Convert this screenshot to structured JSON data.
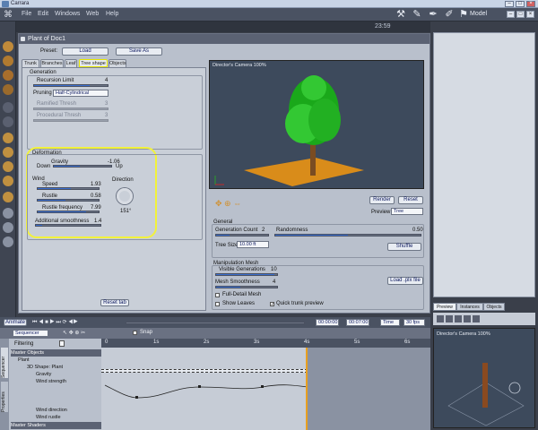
{
  "window": {
    "title": "Carrara",
    "min": "–",
    "max": "□",
    "close": "×"
  },
  "menu": {
    "items": [
      "File",
      "Edit",
      "Windows",
      "Web",
      "Help"
    ],
    "room": "Model",
    "clock": "23:59"
  },
  "plant_panel": {
    "title": "Plant of Doc1",
    "preset_label": "Preset:",
    "load": "Load",
    "save_as": "Save As",
    "tabs": [
      "Trunk",
      "Branches",
      "Leaf",
      "Tree shape",
      "Objects"
    ],
    "active_tab": "Tree shape",
    "generation": {
      "title": "Generation",
      "recursion_label": "Recursion Limit",
      "recursion_value": "4",
      "recursion_level": 0.75,
      "pruning_label": "Pruning",
      "pruning_value": "Half-Cylindrical",
      "ramified_label": "Ramified Thresh",
      "ramified_value": "3",
      "procedural_label": "Procedural Thresh",
      "procedural_value": "3"
    },
    "deformation": {
      "title": "Deformation",
      "gravity_label": "Gravity",
      "gravity_value": "-1.06",
      "gravity_level": 0.45,
      "down": "Down",
      "up": "Up",
      "wind_label": "Wind",
      "speed_label": "Speed",
      "speed_value": "1.93",
      "speed_level": 0.55,
      "rustle_label": "Rustle",
      "rustle_value": "0.58",
      "rustle_level": 0.45,
      "rustle_freq_label": "Rustle frequency",
      "rustle_freq_value": "7.99",
      "rustle_freq_level": 0.8,
      "smooth_label": "Additional smoothness",
      "smooth_value": "1.4",
      "smooth_level": 0.1,
      "direction_label": "Direction",
      "direction_value": "151°"
    },
    "reset_tab": "Reset tab",
    "viewport_title": "Director's Camera 100%",
    "render": "Render",
    "reset": "Reset",
    "preview_label": "Preview",
    "preview_value": "Tree",
    "general": {
      "title": "General",
      "gen_count_label": "Generation Count",
      "gen_count_value": "2",
      "randomness_label": "Randomness",
      "randomness_value": "0.50",
      "tree_size_label": "Tree Size",
      "tree_size_value": "10.00 ft",
      "shuffle": "Shuffle"
    },
    "manipulation": {
      "title": "Manipulation Mesh",
      "visible_label": "Visible Generations",
      "visible_value": "10",
      "mesh_smooth_label": "Mesh Smoothness",
      "mesh_smooth_value": "4",
      "load_file": "Load .plx file",
      "full_detail": "Full-Detail Mesh",
      "show_leaves": "Show Leaves",
      "quick_trunk": "Quick trunk preview"
    }
  },
  "right_panel": {
    "tabs": [
      "Preview",
      "Instances",
      "Objects"
    ],
    "camera_title": "Director's Camera 100%"
  },
  "timeline": {
    "animate": "Animate",
    "time1": "00:00:00",
    "time2": "00:07:00",
    "time_select": "Time",
    "fps": "30 fps",
    "sequencer": "Sequencer",
    "snap": "Snap",
    "filtering": "Filtering",
    "ruler": [
      "0",
      "1s",
      "2s",
      "3s",
      "4s",
      "5s",
      "6s"
    ],
    "tracks": [
      "Master Objects",
      "Plant",
      "3D Shape: Plant",
      "Gravity",
      "Wind strength",
      "Wind direction",
      "Wind rustle",
      "Master Shaders"
    ],
    "side_tabs": [
      "Sequencer",
      "Properties"
    ]
  }
}
